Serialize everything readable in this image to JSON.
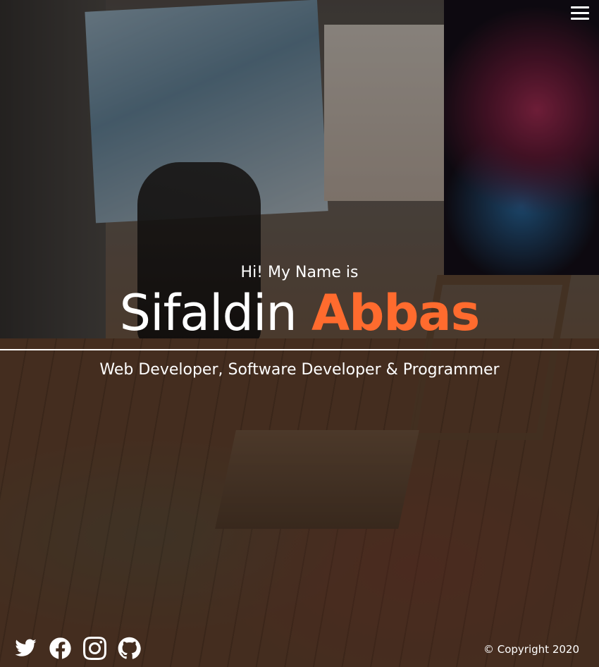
{
  "header": {
    "menu_icon": "hamburger-menu-icon"
  },
  "hero": {
    "greeting": "Hi! My Name is",
    "first_name": "Sifaldin",
    "last_name": "Abbas",
    "tagline": "Web Developer, Software Developer & Programmer"
  },
  "colors": {
    "accent": "#ff6b2e",
    "text": "#ffffff"
  },
  "footer": {
    "social": [
      {
        "name": "twitter",
        "icon": "twitter-icon"
      },
      {
        "name": "facebook",
        "icon": "facebook-icon"
      },
      {
        "name": "instagram",
        "icon": "instagram-icon"
      },
      {
        "name": "github",
        "icon": "github-icon"
      }
    ],
    "copyright": "© Copyright 2020"
  }
}
